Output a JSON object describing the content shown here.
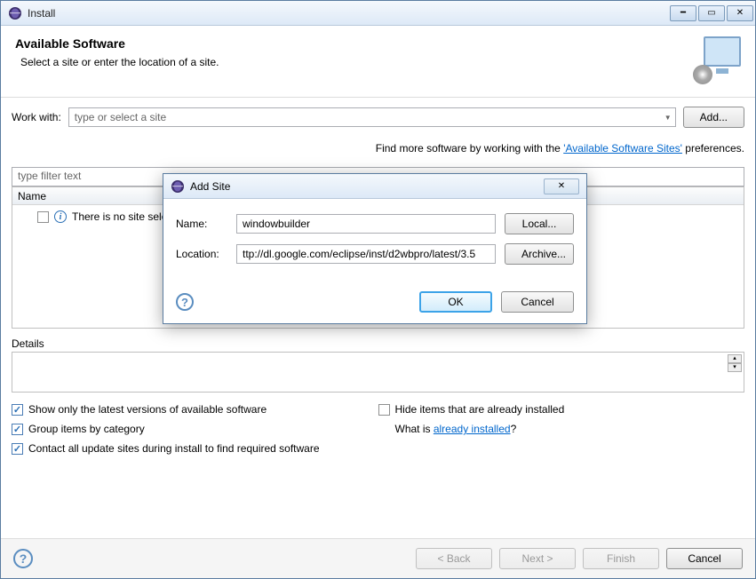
{
  "window": {
    "title": "Install"
  },
  "header": {
    "title": "Available Software",
    "subtitle": "Select a site or enter the location of a site."
  },
  "workwith": {
    "label": "Work with:",
    "placeholder": "type or select a site",
    "add_btn": "Add..."
  },
  "hint": {
    "prefix": "Find more software by working with the ",
    "link": "'Available Software Sites'",
    "suffix": " preferences."
  },
  "filter": {
    "placeholder": "type filter text"
  },
  "tree": {
    "header": "Name",
    "empty_msg": "There is no site selected."
  },
  "details": {
    "label": "Details"
  },
  "options": {
    "left": [
      {
        "label": "Show only the latest versions of available software",
        "checked": true
      },
      {
        "label": "Group items by category",
        "checked": true
      },
      {
        "label": "Contact all update sites during install to find required software",
        "checked": true
      }
    ],
    "right_hide": {
      "label": "Hide items that are already installed",
      "checked": false
    },
    "right_whatis": {
      "prefix": "What is ",
      "link": "already installed",
      "suffix": "?"
    }
  },
  "footer": {
    "back": "< Back",
    "next": "Next >",
    "finish": "Finish",
    "cancel": "Cancel"
  },
  "modal": {
    "title": "Add Site",
    "name_label": "Name:",
    "name_value": "windowbuilder",
    "location_label": "Location:",
    "location_value": "ttp://dl.google.com/eclipse/inst/d2wbpro/latest/3.5",
    "local_btn": "Local...",
    "archive_btn": "Archive...",
    "ok": "OK",
    "cancel": "Cancel"
  }
}
